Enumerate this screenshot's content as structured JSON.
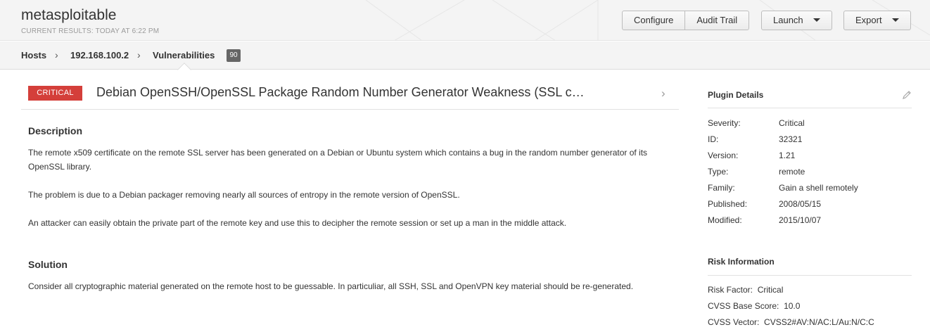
{
  "header": {
    "title": "metasploitable",
    "subtitle": "CURRENT RESULTS: TODAY AT 6:22 PM",
    "buttons": {
      "configure": "Configure",
      "audit_trail": "Audit Trail",
      "launch": "Launch",
      "export": "Export"
    }
  },
  "breadcrumb": {
    "hosts": "Hosts",
    "host": "192.168.100.2",
    "vulnerabilities": "Vulnerabilities",
    "count": "90",
    "separator": "›"
  },
  "vulnerability": {
    "severity": "CRITICAL",
    "title": "Debian OpenSSH/OpenSSL Package Random Number Generator Weakness (SSL c…",
    "next_icon": "chevron-right-icon",
    "severity_color": "#d43f3a"
  },
  "description": {
    "heading": "Description",
    "paragraphs": [
      "The remote x509 certificate on the remote SSL server has been generated on a Debian or Ubuntu system which contains a bug in the random number generator of its OpenSSL library.",
      "The problem is due to a Debian packager removing nearly all sources of entropy in the remote version of OpenSSL.",
      "An attacker can easily obtain the private part of the remote key and use this to decipher the remote session or set up a man in the middle attack."
    ]
  },
  "solution": {
    "heading": "Solution",
    "text": "Consider all cryptographic material generated on the remote host to be guessable. In particuliar, all SSH, SSL and OpenVPN key material should be re-generated."
  },
  "plugin_details": {
    "heading": "Plugin Details",
    "edit_icon": "pencil-icon",
    "rows": [
      {
        "label": "Severity:",
        "value": "Critical"
      },
      {
        "label": "ID:",
        "value": "32321"
      },
      {
        "label": "Version:",
        "value": "1.21"
      },
      {
        "label": "Type:",
        "value": "remote"
      },
      {
        "label": "Family:",
        "value": "Gain a shell remotely"
      },
      {
        "label": "Published:",
        "value": "2008/05/15"
      },
      {
        "label": "Modified:",
        "value": "2015/10/07"
      }
    ]
  },
  "risk_information": {
    "heading": "Risk Information",
    "rows": [
      {
        "label": "Risk Factor:",
        "value": "Critical"
      },
      {
        "label": "CVSS Base Score:",
        "value": "10.0"
      },
      {
        "label": "CVSS Vector:",
        "value": "CVSS2#AV:N/AC:L/Au:N/C:C"
      }
    ]
  }
}
